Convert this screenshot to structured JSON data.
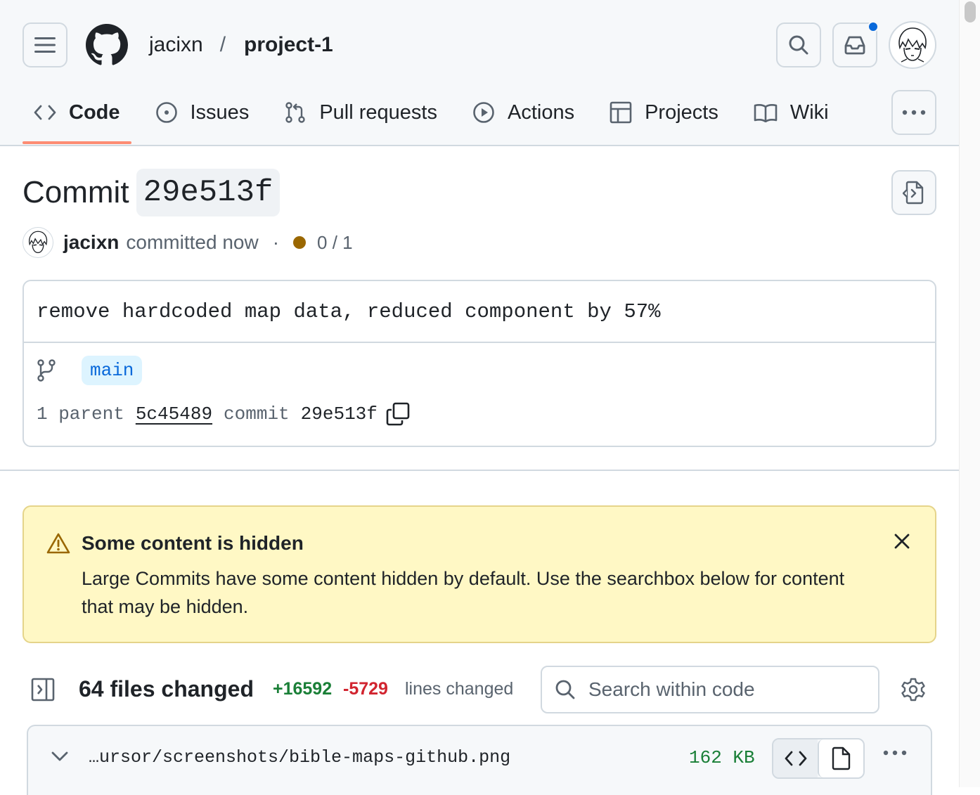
{
  "header": {
    "owner": "jacixn",
    "separator": "/",
    "repo": "project-1"
  },
  "tabs": [
    {
      "label": "Code",
      "icon": "code-icon",
      "active": true
    },
    {
      "label": "Issues",
      "icon": "issue-opened-icon",
      "active": false
    },
    {
      "label": "Pull requests",
      "icon": "git-pull-request-icon",
      "active": false
    },
    {
      "label": "Actions",
      "icon": "play-icon",
      "active": false
    },
    {
      "label": "Projects",
      "icon": "table-icon",
      "active": false
    },
    {
      "label": "Wiki",
      "icon": "book-icon",
      "active": false
    }
  ],
  "commit": {
    "title_prefix": "Commit",
    "short_sha": "29e513f",
    "author": "jacixn",
    "action": "committed now",
    "dot": "·",
    "checks": "0 / 1",
    "message": "remove hardcoded map data, reduced component by 57%",
    "branch": "main",
    "parent_label": "1 parent",
    "parent_sha": "5c45489",
    "commit_label": "commit",
    "commit_sha": "29e513f"
  },
  "flash": {
    "title": "Some content is hidden",
    "body": "Large Commits have some content hidden by default. Use the searchbox below for content that may be hidden."
  },
  "files": {
    "count_label": "64 files changed",
    "additions": "+16592",
    "deletions": "-5729",
    "lines_label": "lines changed",
    "search_placeholder": "Search within code"
  },
  "file_entry": {
    "path": "…ursor/screenshots/bible-maps-github.png",
    "size": "162 KB"
  },
  "colors": {
    "accent_underline": "#fd8c73",
    "addition": "#1a7f37",
    "deletion": "#d1242f",
    "status_pending": "#9a6700",
    "notification": "#0969da",
    "flash_bg": "#fff8c5"
  }
}
